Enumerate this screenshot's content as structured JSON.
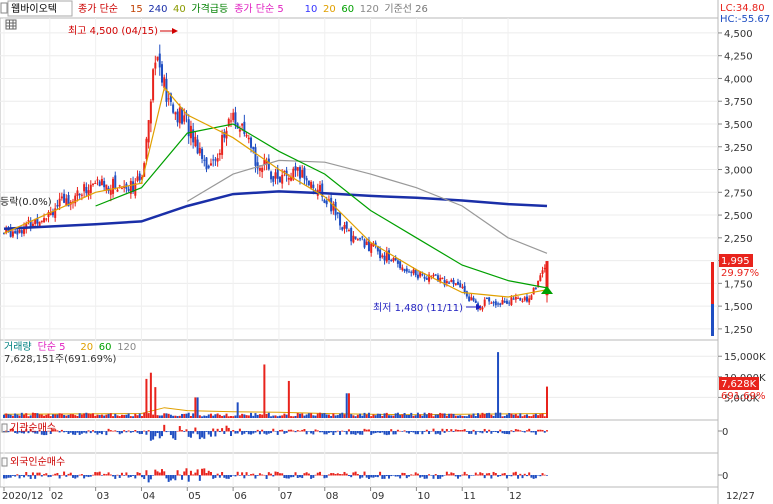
{
  "header": {
    "stock_name": "웹바이오텍",
    "legend": [
      {
        "text": "종가 단순",
        "color": "#cc0000"
      },
      {
        "text": "15",
        "color": "#c04000"
      },
      {
        "text": "240",
        "color": "#1a2fa8"
      },
      {
        "text": "40",
        "color": "#8a9a00"
      },
      {
        "text": "가격급등",
        "color": "#008000"
      },
      {
        "text": "종가 단순 5",
        "color": "#e020c0"
      },
      {
        "text": "10",
        "color": "#3333ff"
      },
      {
        "text": "20",
        "color": "#e0a000"
      },
      {
        "text": "60",
        "color": "#00a000"
      },
      {
        "text": "120",
        "color": "#888888"
      },
      {
        "text": "기준선 26",
        "color": "#777777"
      }
    ],
    "lc_label": "LC:34.80",
    "hc_label": "HC:-55.67"
  },
  "price_panel": {
    "y_ticks": [
      "4,500",
      "4,250",
      "4,000",
      "3,750",
      "3,500",
      "3,250",
      "3,000",
      "2,750",
      "2,500",
      "2,250",
      "2,000",
      "1,750",
      "1,500",
      "1,250"
    ],
    "current_price_label": "1,995",
    "change_label": "29.97%",
    "high_annotation": "최고 4,500 (04/15)",
    "low_annotation": "최저 1,480 (11/11)",
    "left_annotation": "등락(0.0%)"
  },
  "volume_panel": {
    "legend": [
      {
        "text": "거래량",
        "color": "#008080"
      },
      {
        "text": "단순 5",
        "color": "#e020c0"
      },
      {
        "text": "20",
        "color": "#e0a000"
      },
      {
        "text": "60",
        "color": "#00a000"
      },
      {
        "text": "120",
        "color": "#888888"
      }
    ],
    "sub_label": "7,628,151주(691.69%)",
    "y_ticks": [
      "15,000K",
      "10,000K",
      "5,000K"
    ],
    "current_label": "7,628K",
    "percent_label": "691.69%"
  },
  "inst_panel": {
    "title": "기관순매수",
    "zero_label": "0"
  },
  "foreign_panel": {
    "title": "외국인순매수",
    "zero_label": "0"
  },
  "x_axis": {
    "labels": [
      "2020/12",
      "02",
      "03",
      "04",
      "05",
      "06",
      "07",
      "08",
      "09",
      "10",
      "11",
      "12"
    ],
    "right_label": "12/27"
  },
  "colors": {
    "up": "#e8231c",
    "down": "#1f4ec2",
    "accent": "#c8000c"
  },
  "chart_data": {
    "type": "candlestick",
    "price_range": [
      1150,
      4620
    ],
    "high": {
      "value": 4500,
      "date": "04/15"
    },
    "low": {
      "value": 1480,
      "date": "11/11"
    },
    "last_close": 1995,
    "close_profile": [
      {
        "x": 0,
        "value": 2300
      },
      {
        "x": 0.5,
        "value": 2380
      },
      {
        "x": 1,
        "value": 2550
      },
      {
        "x": 1.5,
        "value": 2700
      },
      {
        "x": 2,
        "value": 2850
      },
      {
        "x": 2.5,
        "value": 2820
      },
      {
        "x": 3,
        "value": 2850
      },
      {
        "x": 3.15,
        "value": 3600
      },
      {
        "x": 3.3,
        "value": 4300
      },
      {
        "x": 3.6,
        "value": 3700
      },
      {
        "x": 4,
        "value": 3500
      },
      {
        "x": 4.5,
        "value": 3000
      },
      {
        "x": 5,
        "value": 3600
      },
      {
        "x": 5.5,
        "value": 3100
      },
      {
        "x": 6,
        "value": 2900
      },
      {
        "x": 6.5,
        "value": 2950
      },
      {
        "x": 7,
        "value": 2700
      },
      {
        "x": 7.5,
        "value": 2300
      },
      {
        "x": 8,
        "value": 2150
      },
      {
        "x": 8.5,
        "value": 2000
      },
      {
        "x": 9,
        "value": 1850
      },
      {
        "x": 9.5,
        "value": 1800
      },
      {
        "x": 10,
        "value": 1700
      },
      {
        "x": 10.3,
        "value": 1500
      },
      {
        "x": 10.6,
        "value": 1560
      },
      {
        "x": 11,
        "value": 1550
      },
      {
        "x": 11.5,
        "value": 1600
      },
      {
        "x": 11.85,
        "value": 1995
      }
    ],
    "ma_lines": [
      {
        "name": "240",
        "color": "#1a2fa8",
        "values": [
          [
            0,
            2350
          ],
          [
            2,
            2400
          ],
          [
            3,
            2430
          ],
          [
            4,
            2600
          ],
          [
            5,
            2730
          ],
          [
            6,
            2760
          ],
          [
            7,
            2740
          ],
          [
            8,
            2710
          ],
          [
            9,
            2690
          ],
          [
            10,
            2660
          ],
          [
            11,
            2620
          ],
          [
            11.85,
            2600
          ]
        ]
      },
      {
        "name": "120",
        "color": "#999999",
        "values": [
          [
            4,
            2650
          ],
          [
            5,
            2950
          ],
          [
            6,
            3100
          ],
          [
            7,
            3080
          ],
          [
            8,
            2950
          ],
          [
            9,
            2800
          ],
          [
            10,
            2600
          ],
          [
            11,
            2250
          ],
          [
            11.85,
            2080
          ]
        ]
      },
      {
        "name": "60",
        "color": "#00a000",
        "values": [
          [
            2,
            2600
          ],
          [
            3,
            2800
          ],
          [
            4,
            3400
          ],
          [
            5,
            3500
          ],
          [
            6,
            3200
          ],
          [
            7,
            2950
          ],
          [
            8,
            2550
          ],
          [
            9,
            2250
          ],
          [
            10,
            1950
          ],
          [
            11,
            1780
          ],
          [
            11.85,
            1700
          ]
        ]
      },
      {
        "name": "20",
        "color": "#e0a000",
        "values": [
          [
            0,
            2300
          ],
          [
            2,
            2750
          ],
          [
            3,
            2850
          ],
          [
            3.5,
            3900
          ],
          [
            4,
            3600
          ],
          [
            5,
            3350
          ],
          [
            6,
            3000
          ],
          [
            7,
            2700
          ],
          [
            8,
            2200
          ],
          [
            9,
            1900
          ],
          [
            10,
            1650
          ],
          [
            11,
            1600
          ],
          [
            11.85,
            1680
          ]
        ]
      }
    ],
    "volume_unit": "K",
    "volume_peak": 16000,
    "volume_last": 7628,
    "volume_spikes": [
      {
        "x": 3.1,
        "value": 9500
      },
      {
        "x": 3.2,
        "value": 11000
      },
      {
        "x": 3.3,
        "value": 7500
      },
      {
        "x": 4.2,
        "value": 5000
      },
      {
        "x": 5.1,
        "value": 3800
      },
      {
        "x": 5.7,
        "value": 13000
      },
      {
        "x": 6.2,
        "value": 9000
      },
      {
        "x": 7.5,
        "value": 6000
      },
      {
        "x": 10.8,
        "value": 16000
      },
      {
        "x": 11.85,
        "value": 7628
      }
    ]
  }
}
